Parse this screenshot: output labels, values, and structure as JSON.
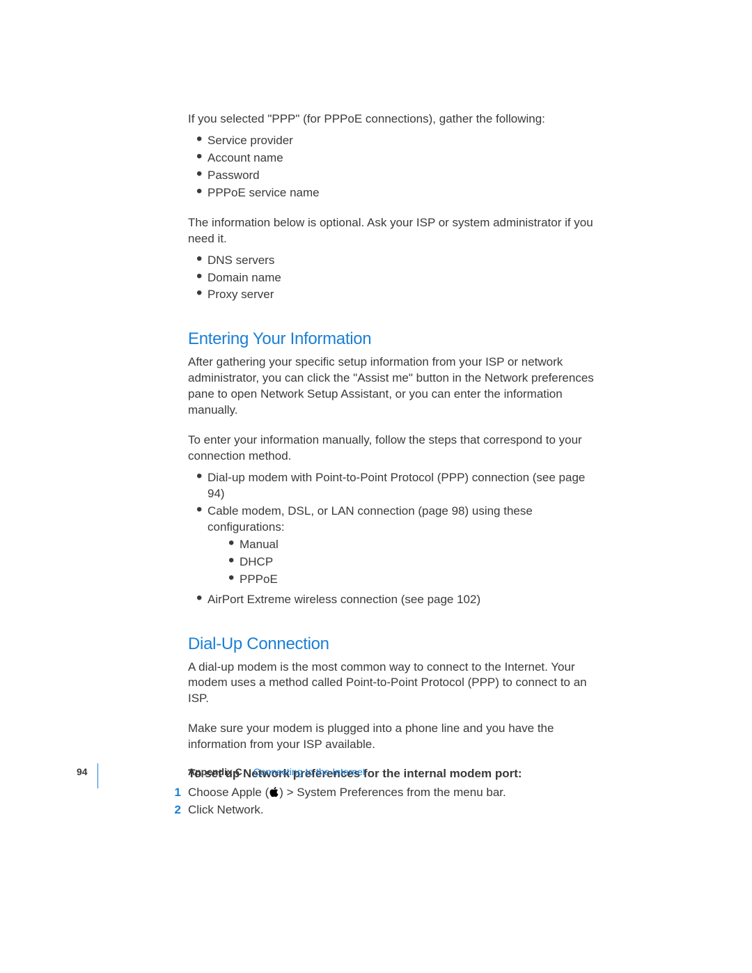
{
  "intro": {
    "para1": "If you selected \"PPP\" (for PPPoE connections), gather the following:",
    "list1": [
      "Service provider",
      "Account name",
      "Password",
      "PPPoE service name"
    ],
    "para2": "The information below is optional. Ask your ISP or system administrator if you need it.",
    "list2": [
      "DNS servers",
      "Domain name",
      "Proxy server"
    ]
  },
  "section1": {
    "heading": "Entering Your Information",
    "para1": "After gathering your specific setup information from your ISP or network administrator, you can click the \"Assist me\" button in the Network preferences pane to open Network Setup Assistant, or you can enter the information manually.",
    "para2": "To enter your information manually, follow the steps that correspond to your connection method.",
    "list": {
      "item1": "Dial-up modem with Point-to-Point Protocol (PPP) connection (see page 94)",
      "item2": "Cable modem, DSL, or LAN connection (page 98) using these configurations:",
      "item2_sub": [
        "Manual",
        "DHCP",
        "PPPoE"
      ],
      "item3": "AirPort Extreme wireless connection (see page 102)"
    }
  },
  "section2": {
    "heading": "Dial-Up Connection",
    "para1": "A dial-up modem is the most common way to connect to the Internet. Your modem uses a method called Point-to-Point Protocol (PPP) to connect to an ISP.",
    "para2": "Make sure your modem is plugged into a phone line and you have the information from your ISP available.",
    "steps_intro": "To set up Network preferences for the internal modem port:",
    "step1_num": "1",
    "step1_pre": "Choose Apple (",
    "step1_post": ") > System Preferences from the menu bar.",
    "step2_num": "2",
    "step2": "Click Network."
  },
  "footer": {
    "page_number": "94",
    "appendix_label": "Appendix C",
    "appendix_title": "Connecting to the Internet"
  }
}
